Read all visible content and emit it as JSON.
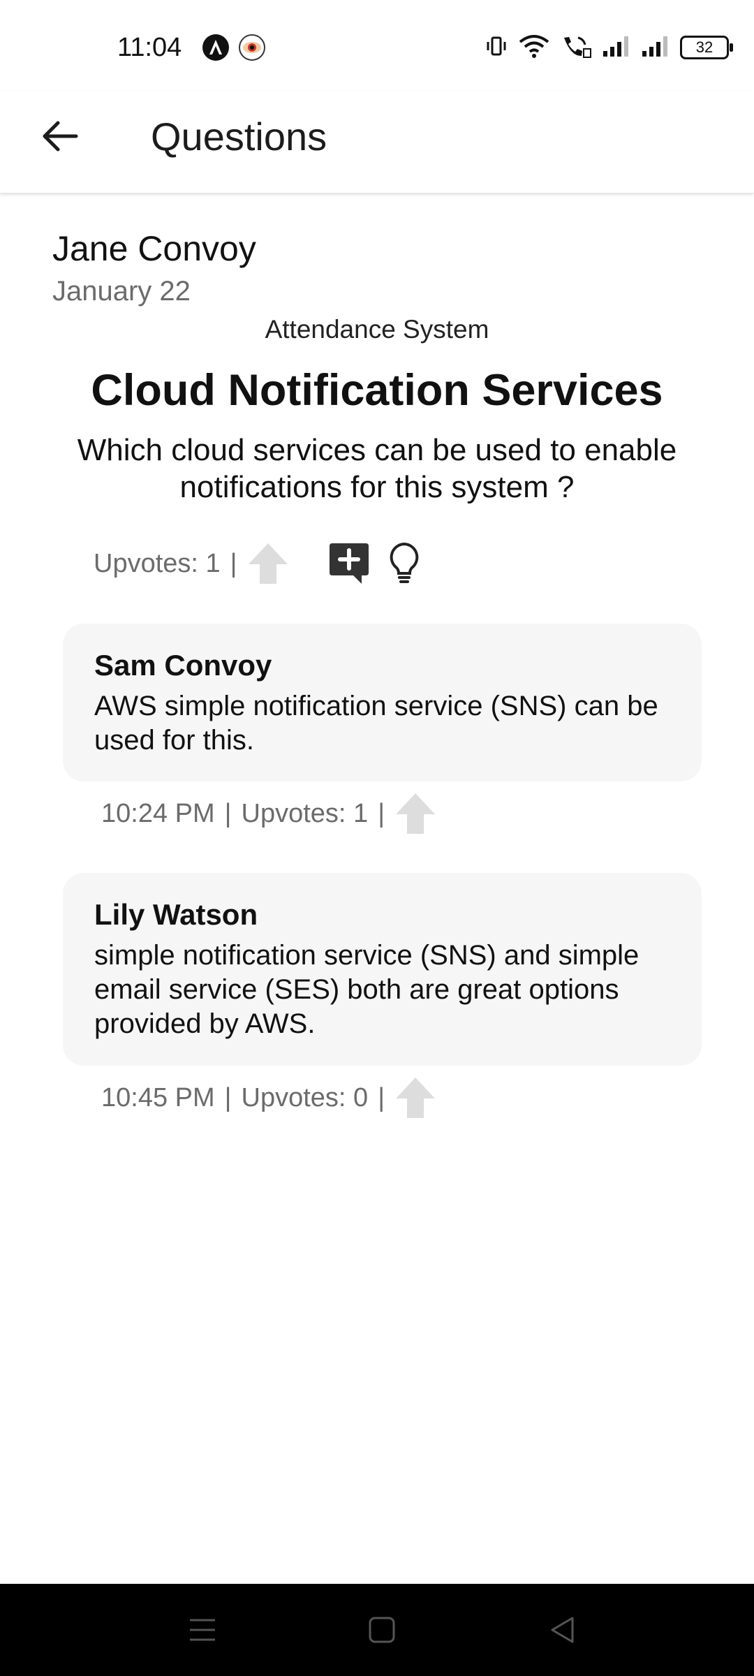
{
  "status_bar": {
    "time": "11:04",
    "battery": "32",
    "icons": [
      "app-a-icon",
      "eye-app-icon",
      "vibrate-icon",
      "wifi-icon",
      "wifi-call-icon",
      "signal-icon",
      "signal-icon"
    ]
  },
  "app_bar": {
    "title": "Questions",
    "back_icon": "back-arrow-icon"
  },
  "question": {
    "author": "Jane Convoy",
    "date": "January 22",
    "project": "Attendance System",
    "title": "Cloud Notification Services",
    "body": "Which cloud services can be used to enable notifications for this system ?",
    "upvotes_label": "Upvotes: 1",
    "separator": "|",
    "actions": [
      "upvote-arrow-icon",
      "add-comment-icon",
      "lightbulb-icon"
    ]
  },
  "answers": [
    {
      "author": "Sam Convoy",
      "text": "AWS simple notification service (SNS) can be used for this.",
      "time": "10:24 PM",
      "upvotes_label": "Upvotes: 1"
    },
    {
      "author": "Lily Watson",
      "text": "simple notification service (SNS) and simple email service (SES) both are great options provided by AWS.",
      "time": "10:45 PM",
      "upvotes_label": "Upvotes: 0"
    }
  ],
  "separator": "|",
  "colors": {
    "text": "#111111",
    "muted": "#6b6b6b",
    "card_bg": "#f6f6f6",
    "upvote_arrow": "#dddddd",
    "nav_bar": "#000000"
  }
}
